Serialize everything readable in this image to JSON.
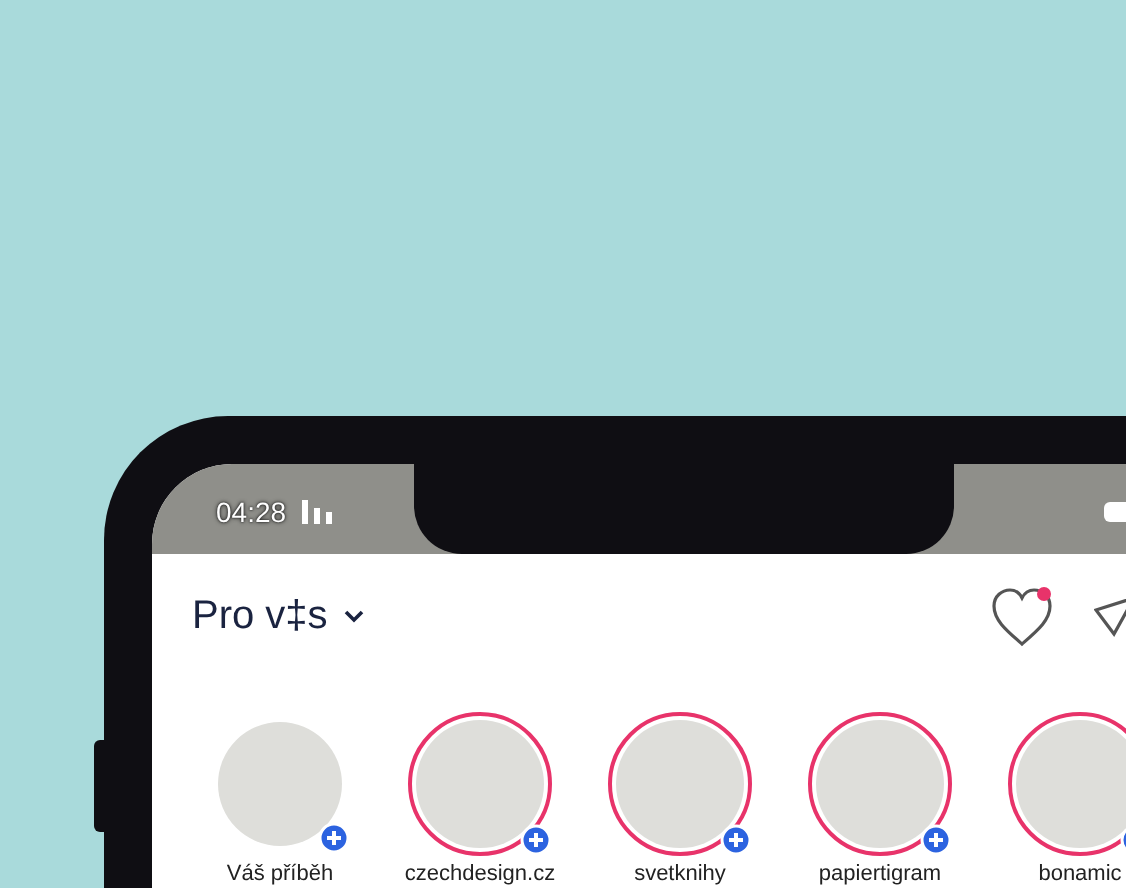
{
  "status_bar": {
    "time": "04:28"
  },
  "header": {
    "title": "Pro v‡s",
    "notification": true
  },
  "stories": [
    {
      "name": "Váš příběh",
      "ring": false
    },
    {
      "name": "czechdesign.cz",
      "ring": true
    },
    {
      "name": "svetknihy",
      "ring": true
    },
    {
      "name": "papiertigram",
      "ring": true
    },
    {
      "name": "bonamic",
      "ring": true
    }
  ]
}
